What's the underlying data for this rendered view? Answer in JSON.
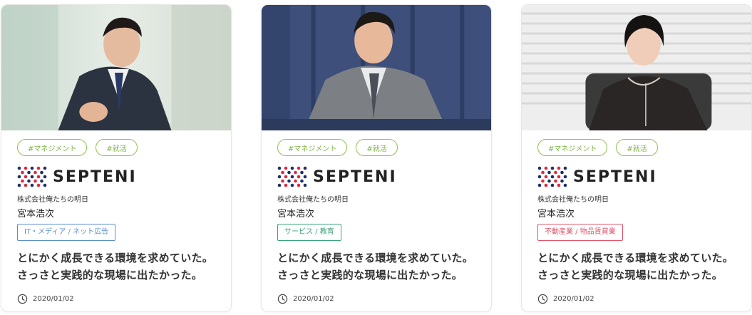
{
  "cards": [
    {
      "tags": [
        "#マネジメント",
        "#就活"
      ],
      "logo_text": "SEPTENI",
      "company": "株式会社俺たちの明日",
      "person": "宮本浩次",
      "industry": {
        "label": "IT・メディア / ネット広告",
        "color": "#5b8fc9"
      },
      "headline": [
        "とにかく成長できる環境を求めていた。",
        "さっさと実践的な現場に出たかった。"
      ],
      "date": "2020/01/02",
      "photo_icon": "man-in-suit-photo"
    },
    {
      "tags": [
        "#マネジメント",
        "#就活"
      ],
      "logo_text": "SEPTENI",
      "company": "株式会社俺たちの明日",
      "person": "宮本浩次",
      "industry": {
        "label": "サービス / 教育",
        "color": "#3aa37a"
      },
      "headline": [
        "とにかく成長できる環境を求めていた。",
        "さっさと実践的な現場に出たかった。"
      ],
      "date": "2020/01/02",
      "photo_icon": "man-in-gray-suit-photo"
    },
    {
      "tags": [
        "#マネジメント",
        "#就活"
      ],
      "logo_text": "SEPTENI",
      "company": "株式会社俺たちの明日",
      "person": "宮本浩次",
      "industry": {
        "label": "不動産業 / 物品賃貸業",
        "color": "#e0546a"
      },
      "headline": [
        "とにかく成長できる環境を求めていた。",
        "さっさと実践的な現場に出たかった。"
      ],
      "date": "2020/01/02",
      "photo_icon": "woman-in-black-photo"
    }
  ],
  "colors": {
    "tag_green": "#7cb342",
    "logo_red": "#e02a3c",
    "logo_navy": "#1f2f6b"
  }
}
